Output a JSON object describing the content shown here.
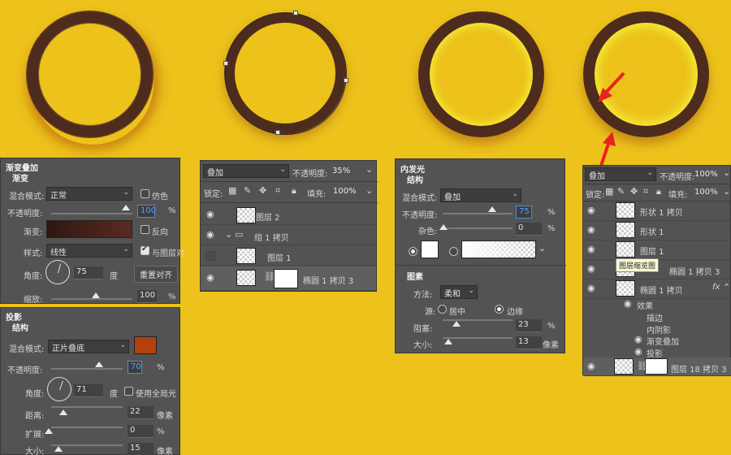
{
  "colors": {
    "bg": "#ecc21b",
    "ring_dark": "#4e2c1d",
    "shadow_color": "#b5400c",
    "arrow": "#e8231e",
    "glow": "#f6ef3a"
  },
  "gradient_panel": {
    "title": "渐变叠加",
    "section": "渐变",
    "blend_label": "混合模式:",
    "blend_value": "正常",
    "dither_label": "仿色",
    "opacity_label": "不透明度:",
    "opacity_value": "100",
    "opacity_unit": "%",
    "gradient_label": "渐变:",
    "reverse_label": "反向",
    "style_label": "样式:",
    "style_value": "线性",
    "align_label": "与图层对",
    "angle_label": "角度:",
    "angle_value": "75",
    "angle_unit": "度",
    "reset_label": "重置对齐",
    "scale_label": "缩放:",
    "scale_value": "100",
    "scale_unit": "%"
  },
  "shadow_panel": {
    "title": "投影",
    "section": "结构",
    "blend_label": "混合模式:",
    "blend_value": "正片叠底",
    "opacity_label": "不透明度:",
    "opacity_value": "70",
    "opacity_unit": "%",
    "angle_label": "角度:",
    "angle_value": "71",
    "angle_unit": "度",
    "global_label": "使用全局光",
    "distance_label": "距离:",
    "distance_value": "22",
    "distance_unit": "像素",
    "spread_label": "扩展:",
    "spread_value": "0",
    "spread_unit": "%",
    "size_label": "大小:",
    "size_value": "15",
    "size_unit": "像素"
  },
  "layers_panel_1": {
    "blend_value": "叠加",
    "opacity_label": "不透明度:",
    "opacity_value": "35%",
    "lock_label": "锁定:",
    "fill_label": "填充:",
    "fill_value": "100%",
    "layers": [
      "图层 2",
      "组 1 拷贝",
      "图层 1",
      "椭圆 1 拷贝 3"
    ]
  },
  "inner_glow_panel": {
    "title": "内发光",
    "section": "结构",
    "blend_label": "混合模式:",
    "blend_value": "叠加",
    "opacity_label": "不透明度:",
    "opacity_value": "75",
    "opacity_unit": "%",
    "noise_label": "杂色:",
    "noise_value": "0",
    "noise_unit": "%",
    "elements_title": "图素",
    "method_label": "方法:",
    "method_value": "柔和",
    "source_label": "源:",
    "source_center": "居中",
    "source_edge": "边缘",
    "choke_label": "阻塞:",
    "choke_value": "23",
    "choke_unit": "%",
    "size_label": "大小:",
    "size_value": "13",
    "size_unit": "像素"
  },
  "layers_panel_2": {
    "blend_value": "叠加",
    "opacity_label": "不透明度:",
    "opacity_value": "100%",
    "lock_label": "锁定:",
    "fill_label": "填充:",
    "fill_value": "100%",
    "layers": [
      "形状 1 拷贝",
      "形状 1",
      "图层 1",
      "椭圆 1 拷贝 3",
      "椭圆 1 拷贝",
      "图层 18 拷贝 3"
    ],
    "tooltip": "图层缩览图",
    "fx": "fx",
    "effects_label": "效果",
    "effects": [
      "描边",
      "内阴影",
      "渐变叠加",
      "投影"
    ]
  }
}
